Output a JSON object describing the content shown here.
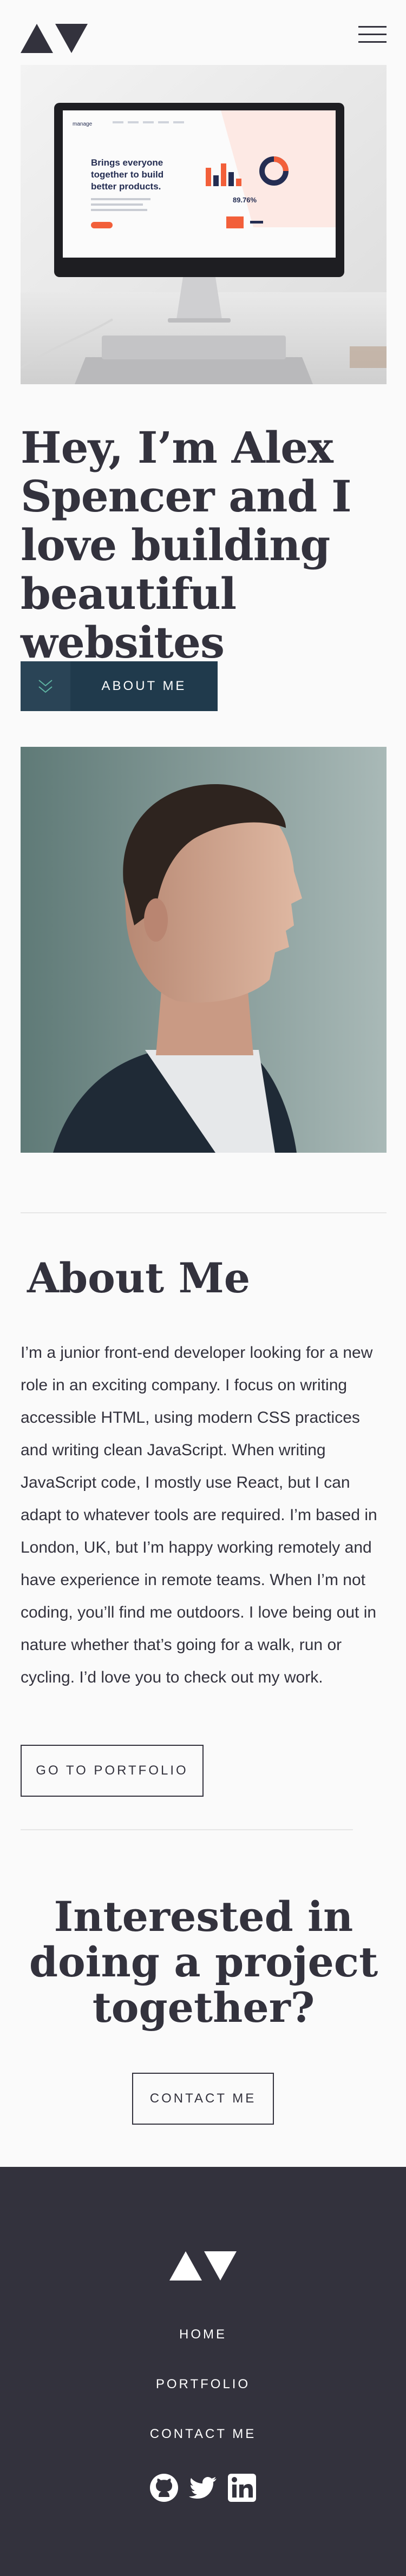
{
  "header": {
    "logo_icon": "triangles-logo-icon",
    "menu_icon": "hamburger-menu-icon"
  },
  "hero": {
    "image_icon": "monitor-desk-illustration",
    "headline": "Hey, I’m Alex Spencer and I love building beautiful websites",
    "about_button": "ABOUT ME",
    "about_button_icon": "double-chevron-down-icon"
  },
  "hero_mockup": {
    "brand": "manage",
    "tagline": "Brings everyone together to build better products.",
    "stat": "89.76%"
  },
  "profile": {
    "image_icon": "profile-photo"
  },
  "about": {
    "title": "About Me",
    "body": "I’m a junior front-end developer looking for a new role in an exciting company. I focus on writing accessible HTML, using modern CSS practices and writing clean JavaScript. When writing JavaScript code, I mostly use React, but I can adapt to whatever tools are required. I’m based in London, UK, but I’m happy working remotely and have experience in remote teams. When I’m not coding, you’ll find me outdoors. I love being out in nature whether that’s going for a walk, run or cycling. I’d love you to check out my work.",
    "portfolio_button": "GO TO PORTFOLIO"
  },
  "cta": {
    "title": "Interested in doing a project together?",
    "contact_button": "CONTACT ME"
  },
  "footer": {
    "nav": [
      "HOME",
      "PORTFOLIO",
      "CONTACT ME"
    ],
    "social_icons": [
      "github-icon",
      "twitter-icon",
      "linkedin-icon"
    ]
  },
  "colors": {
    "dark": "#33323d",
    "navy": "#203a4c",
    "background": "#fafafa",
    "accent": "#5fb4a2"
  }
}
